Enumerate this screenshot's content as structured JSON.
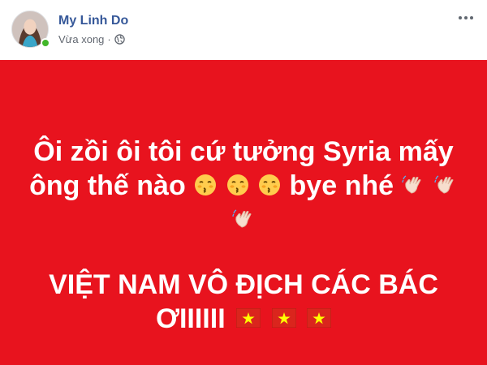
{
  "post": {
    "author_name": "My Linh Do",
    "timestamp": "Vừa xong",
    "separator": "·",
    "privacy_icon": "globe-icon",
    "more_icon": "more-options-icon"
  },
  "content": {
    "background_color": "#e8131e",
    "line1": "Ôi zồi ôi tôi cứ tưởng Syria mấy",
    "line2_text_a": "ông thế nào",
    "line2_text_b": "bye nhé",
    "line4": "VIỆT NAM VÔ ĐỊCH CÁC BÁC",
    "line5": "ƠIIIIII",
    "emojis": [
      "kissing-face-icon",
      "kissing-face-icon",
      "kissing-face-icon"
    ],
    "hand_emojis": [
      "waving-hand-icon",
      "waving-hand-icon",
      "waving-hand-icon"
    ],
    "flags": [
      "vietnam-flag-icon",
      "vietnam-flag-icon",
      "vietnam-flag-icon"
    ]
  }
}
